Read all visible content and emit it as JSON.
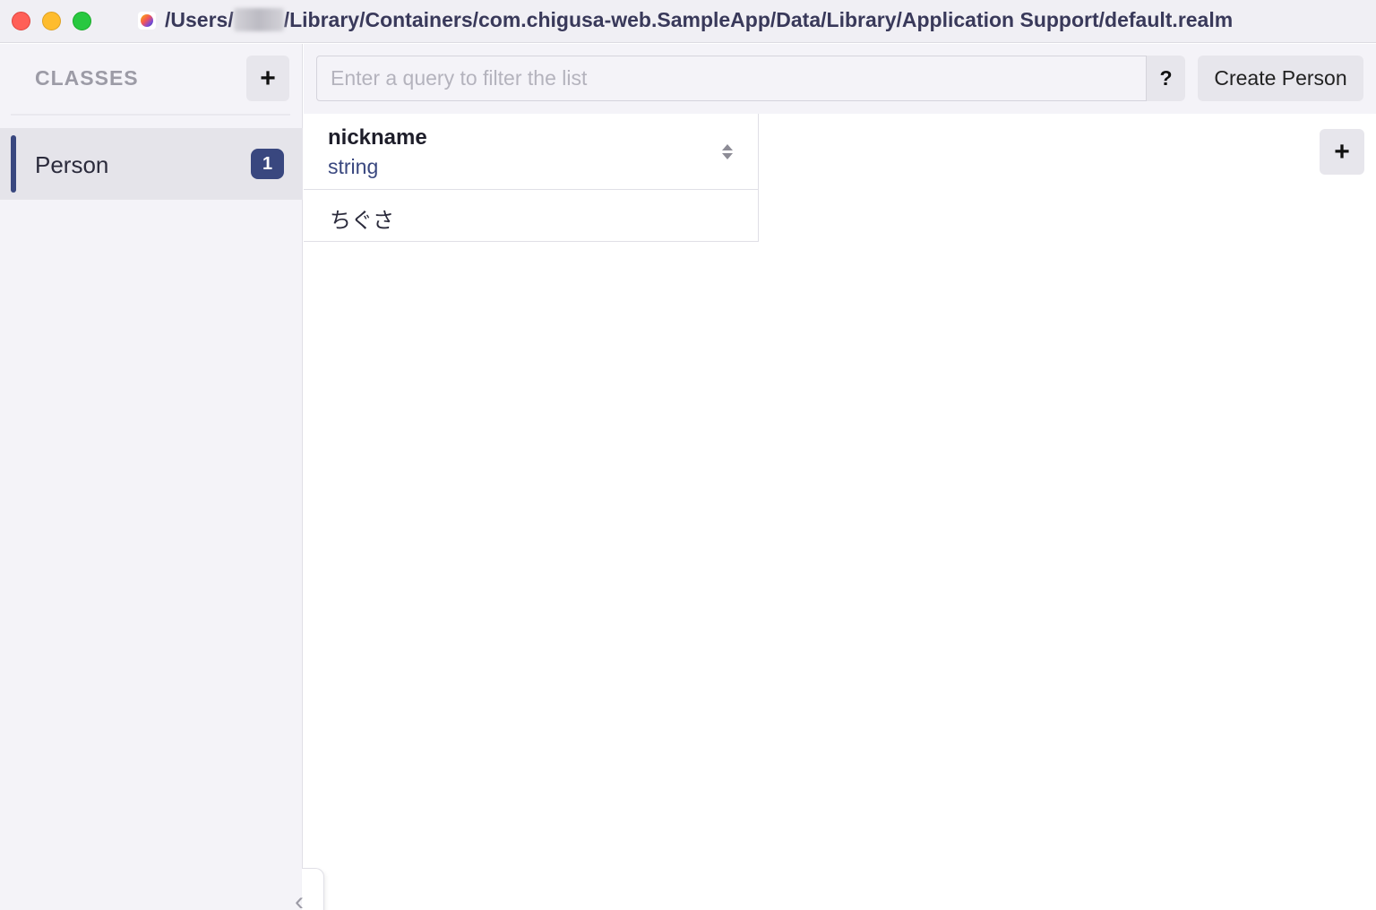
{
  "window": {
    "title_prefix": "/Users/",
    "title_suffix": "/Library/Containers/com.chigusa-web.SampleApp/Data/Library/Application Support/default.realm"
  },
  "sidebar": {
    "title": "CLASSES",
    "add_label": "+",
    "collapse_label": "‹",
    "classes": [
      {
        "name": "Person",
        "count": "1",
        "selected": true
      }
    ]
  },
  "toolbar": {
    "search_placeholder": "Enter a query to filter the list",
    "search_value": "",
    "help_label": "?",
    "create_label": "Create Person"
  },
  "table": {
    "columns": [
      {
        "name": "nickname",
        "type": "string"
      }
    ],
    "rows": [
      [
        "ちぐさ"
      ]
    ],
    "add_property_label": "+"
  },
  "colors": {
    "accent": "#39477f",
    "sidebar_bg": "#f4f3f8",
    "button_bg": "#e7e6ec"
  }
}
